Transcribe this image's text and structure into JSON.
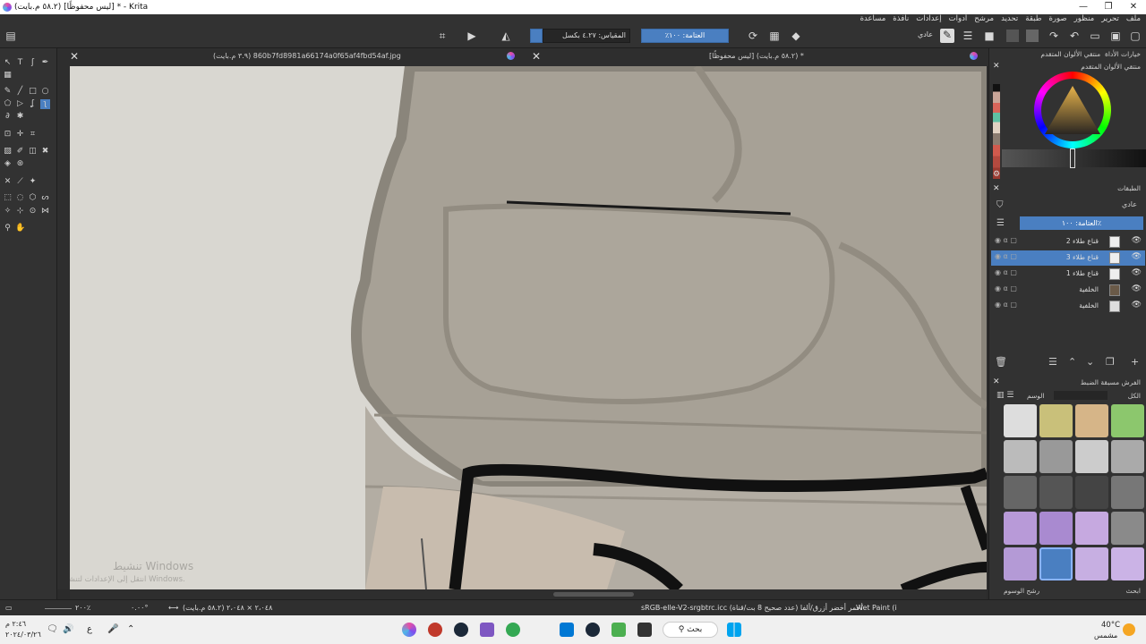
{
  "window": {
    "title": "(٥٨.٢ م.بايت) [ليس محفوظًا] * - Krita",
    "controls": [
      "—",
      "❐",
      "✕"
    ]
  },
  "menu": [
    "ملف",
    "تحرير",
    "منظور",
    "صورة",
    "طبقة",
    "تحديد",
    "مرشح",
    "أدوات",
    "إعدادات",
    "نافذة",
    "مساعدة"
  ],
  "toolbar": {
    "scale_label": "المقياس: ٤.٢٧ بكسل",
    "opacity_label": "العتامة: ١٠٠٪",
    "blend_mode": "عادي"
  },
  "tabs": [
    {
      "title": "(٣.٩ م.بايت) 860b7fd8981a66174a0f65af4fbd54af.jpg"
    },
    {
      "title": "[ليس محفوظًا] (٥٨.٢ م.بايت) *"
    }
  ],
  "canvas": {
    "watermark_title": "تنشيط Windows",
    "watermark_sub": "انتقل إلى الإعدادات لتنشيط Windows."
  },
  "dock": {
    "color_tabs": [
      "منتقي الألوان المتقدم",
      "خيارات الأداة"
    ],
    "color_panel_title": "منتقي الألوان المتقدم",
    "layers_title": "الطبقات",
    "layers_blend": "عادي",
    "layers_opacity": "العتامة: ١٠٠٪",
    "layers": [
      {
        "name": "قناع طلاء 2",
        "selected": false
      },
      {
        "name": "قناع طلاء 3",
        "selected": true
      },
      {
        "name": "قناع طلاء 1",
        "selected": false
      },
      {
        "name": "الخلفية",
        "selected": false
      },
      {
        "name": "الخلفية",
        "selected": false
      }
    ],
    "brush_title": "الفرش مسبقة الضبط",
    "brush_tag_label": "الوسم",
    "brush_filter_label": "الكل",
    "brush_search_label": "ابحث",
    "brush_tag_filter": "رشح الوسوم"
  },
  "statusbar": {
    "zoom": "٢٠٠٪",
    "rotation": "٠.٠٠°",
    "size": "٢،٠٤٨ × ٢،٠٤٨ (٥٨.٢ م.بايت)",
    "color_profile": "sRGB-elle-V2-srgbtrc.icc  أحمر أخضر أزرق/ألفا (عدد صحيح 8 بت/قناة)",
    "brush_name": "Wet Paint (i"
  },
  "taskbar": {
    "search_label": "بحث",
    "weather_temp": "40°C",
    "weather_desc": "مشمس",
    "time": "٢:٤٦ م",
    "date": "٢٠٢٤/٠٣/٢٦",
    "lang": "ع"
  }
}
